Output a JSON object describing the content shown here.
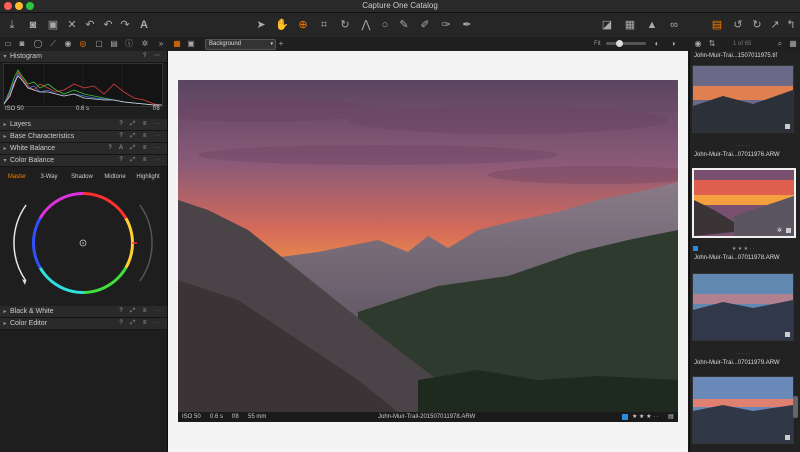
{
  "window": {
    "title": "Capture One Catalog"
  },
  "toolbar": {
    "left_icons": [
      "import-icon",
      "camera-icon",
      "tag-icon",
      "delete-icon",
      "redo-arrow-icon",
      "undo-icon",
      "redo-icon",
      "text-icon"
    ],
    "center_icons": [
      "cursor-tool-icon",
      "hand-tool-icon",
      "zoom-tool-icon",
      "crop-tool-icon",
      "rotate-tool-icon",
      "keystone-tool-icon",
      "circle-tool-icon",
      "picker-tool-icon",
      "brush-tool-icon",
      "eraser-tool-icon",
      "pen-tool-icon"
    ],
    "right_icons": [
      "exposure-warning-icon",
      "grid-icon",
      "warning-icon",
      "glasses-icon",
      "copy-icon",
      "rotate-left-icon",
      "rotate-right-icon",
      "apply-icon",
      "share-icon"
    ]
  },
  "subbar": {
    "background_label": "Background",
    "fit_label": "Fit",
    "counter": "1 of 65"
  },
  "left_panel": {
    "histogram": {
      "title": "Histogram",
      "iso": "ISO 50",
      "shutter": "0.6 s",
      "aperture": "f/8"
    },
    "sections": [
      {
        "id": "layers",
        "title": "Layers"
      },
      {
        "id": "base",
        "title": "Base Characteristics"
      },
      {
        "id": "wb",
        "title": "White Balance"
      },
      {
        "id": "cb",
        "title": "Color Balance"
      },
      {
        "id": "bw",
        "title": "Black & White"
      },
      {
        "id": "ce",
        "title": "Color Editor"
      }
    ],
    "color_balance_tabs": [
      "Master",
      "3-Way",
      "Shadow",
      "Midtone",
      "Highlight"
    ],
    "active_tab": "Master"
  },
  "viewer": {
    "info": {
      "iso": "ISO 50",
      "shutter": "0.6 s",
      "aperture": "f/8",
      "focal": "55 mm"
    },
    "filename": "John-Muir-Trail-2015070119​78.ARW",
    "stars": "★ ★ ★ · ·"
  },
  "browser": {
    "thumbnails": [
      {
        "label": "John-Muir-Trai...15070119​75.tif",
        "stars": "· · · · ·",
        "selected": false,
        "top_label": true
      },
      {
        "label": "John-Muir-Trai...07011976.ARW",
        "stars": "· · · · ·",
        "selected": false
      },
      {
        "label": "John-Muir-Trai...07011978.ARW",
        "stars": "★ ★ ★ · ·",
        "selected": true
      },
      {
        "label": "John-Muir-Trai...07011979.ARW",
        "stars": "· · · · ·",
        "selected": false
      },
      {
        "label": "John-Muir-Trai...07011980.ARW",
        "stars": "· · · · ·",
        "selected": false
      }
    ]
  },
  "colors": {
    "accent": "#ff7a00",
    "panel": "#1e1e1e",
    "viewer_bg": "#f4f4f4"
  }
}
